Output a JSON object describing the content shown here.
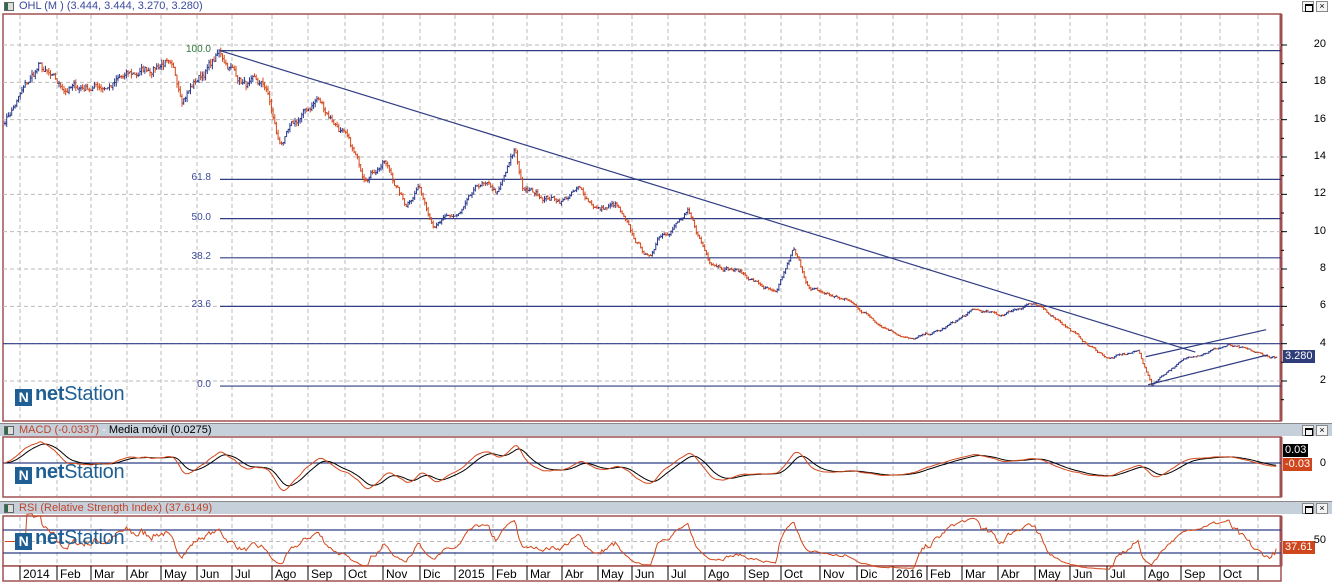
{
  "main_panel": {
    "title": "OHL (M ) (3.444, 3.444, 3.270, 3.280)",
    "last_price_badge": "3.280"
  },
  "macd_panel": {
    "title_macd": "MACD (-0.0337)",
    "title_sep": " - ",
    "title_signal": "Media móvil (0.0275)",
    "badge_signal": "0.03",
    "badge_macd": "-0.03",
    "zero_label": "0"
  },
  "rsi_panel": {
    "title": "RSI (Relative Strength Index) (37.6149)",
    "badge": "37.61",
    "mid_label": "50"
  },
  "watermark": {
    "mark": "N",
    "net": "net",
    "station": "Station"
  },
  "window_buttons": {
    "close": "×"
  },
  "colors": {
    "up": "#2b3a8c",
    "down": "#d4471a",
    "line": "#2f3d84",
    "frame": "#a05050"
  },
  "chart_data": {
    "type": "ohlc",
    "title": "OHL (M )",
    "x_unit": "weeks since Jan 2014",
    "y_ticks": [
      "20",
      "18",
      "16",
      "14",
      "12",
      "10",
      "8",
      "6",
      "4",
      "2"
    ],
    "ylim": [
      0.2,
      21.5
    ],
    "x_labels": [
      "2014",
      "Feb",
      "Mar",
      "Abr",
      "May",
      "Jun",
      "Jul",
      "Ago",
      "Sep",
      "Oct",
      "Nov",
      "Dic",
      "2015",
      "Feb",
      "Mar",
      "Abr",
      "May",
      "Jun",
      "Jul",
      "Ago",
      "Sep",
      "Oct",
      "Nov",
      "Dic",
      "2016",
      "Feb",
      "Mar",
      "Abr",
      "May",
      "Jun",
      "Jul",
      "Ago",
      "Sep",
      "Oct"
    ],
    "close_path": [
      [
        0,
        16.0
      ],
      [
        4,
        18.8
      ],
      [
        6.5,
        17.6
      ],
      [
        12.5,
        17.9
      ],
      [
        15.5,
        18.4
      ],
      [
        19,
        19.2
      ],
      [
        21,
        17.3
      ],
      [
        25.5,
        19.5
      ],
      [
        28.5,
        17.9
      ],
      [
        31,
        17.6
      ],
      [
        32.5,
        14.6
      ],
      [
        35,
        16.0
      ],
      [
        37,
        17.1
      ],
      [
        40,
        15.4
      ],
      [
        42.5,
        13.0
      ],
      [
        45,
        13.8
      ],
      [
        47.5,
        11.4
      ],
      [
        49,
        12.5
      ],
      [
        51,
        10.4
      ],
      [
        54,
        10.9
      ],
      [
        56.5,
        12.5
      ],
      [
        58.5,
        12.0
      ],
      [
        60.5,
        14.3
      ],
      [
        61.5,
        12.2
      ],
      [
        66,
        11.7
      ],
      [
        68,
        12.2
      ],
      [
        70.5,
        11.2
      ],
      [
        72.5,
        11.4
      ],
      [
        74.5,
        9.6
      ],
      [
        76.5,
        8.5
      ],
      [
        77.5,
        9.8
      ],
      [
        81,
        10.9
      ],
      [
        83.5,
        8.5
      ],
      [
        87,
        7.9
      ],
      [
        91.5,
        6.6
      ],
      [
        93.5,
        9.0
      ],
      [
        95.5,
        6.9
      ],
      [
        100,
        6.3
      ],
      [
        104,
        5.0
      ],
      [
        107.5,
        4.2
      ],
      [
        111,
        4.7
      ],
      [
        115,
        5.8
      ],
      [
        118,
        5.5
      ],
      [
        121.5,
        6.2
      ],
      [
        125,
        5.3
      ],
      [
        128.5,
        3.9
      ],
      [
        131,
        3.2
      ],
      [
        134.5,
        3.6
      ],
      [
        136,
        1.8
      ],
      [
        138,
        2.6
      ],
      [
        141,
        3.4
      ],
      [
        145,
        3.9
      ],
      [
        150,
        3.28
      ]
    ],
    "last_ohlc": {
      "open": 3.444,
      "high": 3.444,
      "low": 3.27,
      "close": 3.28
    },
    "fibonacci": {
      "levels": [
        "100.0",
        "61.8",
        "50.0",
        "38.2",
        "23.6",
        "0.0"
      ],
      "prices": [
        19.7,
        12.8,
        10.7,
        8.6,
        6.0,
        1.73
      ]
    },
    "support_line": 4.0,
    "trendline": [
      [
        25.5,
        19.7
      ],
      [
        141.2,
        3.55
      ]
    ],
    "channel_lower": [
      [
        135.6,
        1.8
      ],
      [
        149.8,
        3.4
      ]
    ],
    "channel_upper": [
      [
        135.3,
        3.3
      ],
      [
        149.6,
        4.75
      ]
    ],
    "macd": {
      "fast": 12,
      "slow": 26,
      "value": -0.0337,
      "signal": 0.0275
    },
    "rsi": {
      "value": 37.6149,
      "upper": 70,
      "lower": 30
    }
  }
}
